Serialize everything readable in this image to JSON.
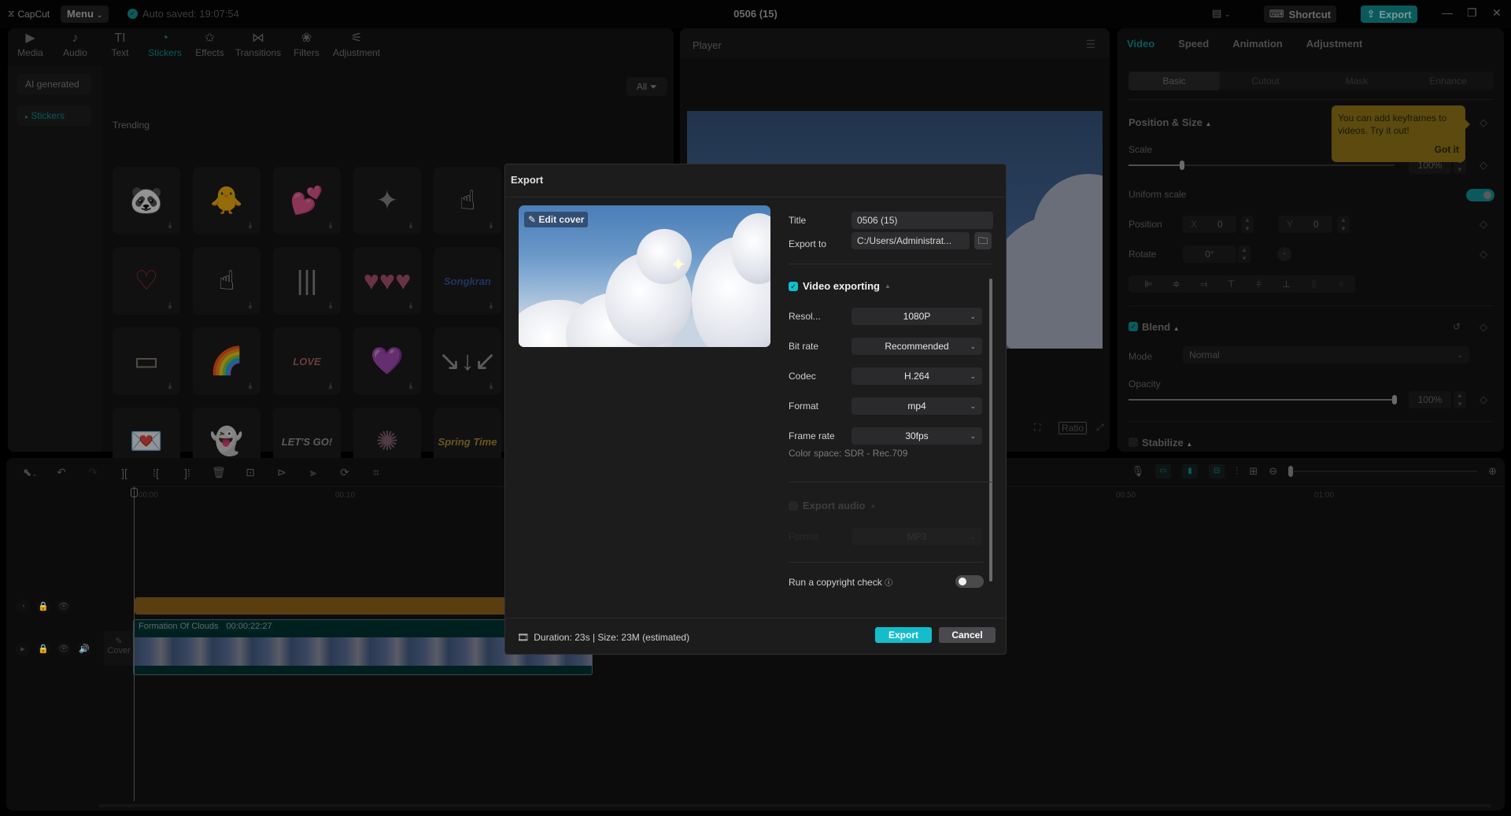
{
  "app": {
    "logo": "CapCut",
    "menu_label": "Menu",
    "autosave": "Auto saved: 19:07:54",
    "window_title": "0506 (15)",
    "shortcut_label": "Shortcut",
    "export_label": "Export",
    "accent_color": "#14bdcc"
  },
  "media_tabs": [
    {
      "label": "Media",
      "icon": "▶"
    },
    {
      "label": "Audio",
      "icon": "♪"
    },
    {
      "label": "Text",
      "icon": "TI"
    },
    {
      "label": "Stickers",
      "icon": "◔"
    },
    {
      "label": "Effects",
      "icon": "✩"
    },
    {
      "label": "Transitions",
      "icon": "⋈"
    },
    {
      "label": "Filters",
      "icon": "❀"
    },
    {
      "label": "Adjustment",
      "icon": "⚟"
    }
  ],
  "media_sidebar": {
    "ai_generated": "AI generated",
    "stickers": "Stickers"
  },
  "media_filter": "All",
  "trending_label": "Trending",
  "stickers": [
    {
      "name": "panda",
      "glyph": "🐼"
    },
    {
      "name": "chick",
      "glyph": "🐥"
    },
    {
      "name": "floating-hearts",
      "glyph": "💕"
    },
    {
      "name": "sparkles",
      "glyph": "✦"
    },
    {
      "name": "pointer-hand",
      "glyph": "☝"
    },
    {
      "name": "red-hearts",
      "glyph": "♡"
    },
    {
      "name": "pixel-hand",
      "glyph": "☝"
    },
    {
      "name": "sound-wave",
      "glyph": "|||"
    },
    {
      "name": "heart-row",
      "glyph": "♥♥♥"
    },
    {
      "name": "songkran",
      "glyph": "Songkran"
    },
    {
      "name": "tape",
      "glyph": "▭"
    },
    {
      "name": "rainbow",
      "glyph": "🌈"
    },
    {
      "name": "love-hearts",
      "glyph": "LOVE"
    },
    {
      "name": "arrow-heart",
      "glyph": "💜"
    },
    {
      "name": "arrows",
      "glyph": "↘↓↙"
    },
    {
      "name": "love-letters",
      "glyph": "💌"
    },
    {
      "name": "ghost",
      "glyph": "👻"
    },
    {
      "name": "lets-go",
      "glyph": "LET'S GO!"
    },
    {
      "name": "burst",
      "glyph": "✺"
    },
    {
      "name": "spring-time",
      "glyph": "Spring Time"
    }
  ],
  "player": {
    "title": "Player",
    "ratio_label": "Ratio"
  },
  "props": {
    "tabs": [
      "Video",
      "Speed",
      "Animation",
      "Adjustment"
    ],
    "subtabs": [
      "Basic",
      "Cutout",
      "Mask",
      "Enhance"
    ],
    "position_size": "Position & Size",
    "scale_label": "Scale",
    "scale_value": "100%",
    "scale_fraction": 0.2,
    "uniform_scale": "Uniform scale",
    "uniform_scale_on": true,
    "position_label": "Position",
    "x_label": "X",
    "x_value": "0",
    "y_label": "Y",
    "y_value": "0",
    "rotate_label": "Rotate",
    "rotate_value": "0°",
    "blend_label": "Blend",
    "mode_label": "Mode",
    "mode_value": "Normal",
    "opacity_label": "Opacity",
    "opacity_value": "100%",
    "opacity_fraction": 1.0,
    "stabilize_label": "Stabilize",
    "tooltip_text": "You can add keyframes to videos. Try it out!",
    "tooltip_button": "Got it"
  },
  "timeline": {
    "ticks": [
      "00:00",
      "00:10",
      "00:50",
      "01:00"
    ],
    "cover_label": "Cover",
    "clip_name": "Formation Of Clouds",
    "clip_duration": "00:00:22:27"
  },
  "export_dialog": {
    "title": "Export",
    "edit_cover": "Edit cover",
    "title_label": "Title",
    "title_value": "0506 (15)",
    "export_to_label": "Export to",
    "export_to_value": "C:/Users/Administrat...",
    "video_exporting_label": "Video exporting",
    "video_exporting_checked": true,
    "resolution_label": "Resol...",
    "resolution_value": "1080P",
    "bitrate_label": "Bit rate",
    "bitrate_value": "Recommended",
    "codec_label": "Codec",
    "codec_value": "H.264",
    "format_label": "Format",
    "format_value": "mp4",
    "framerate_label": "Frame rate",
    "framerate_value": "30fps",
    "color_space": "Color space: SDR - Rec.709",
    "export_audio_label": "Export audio",
    "export_audio_checked": false,
    "audio_format_label": "Format",
    "audio_format_value": "MP3",
    "copyright_label": "Run a copyright check",
    "copyright_on": false,
    "duration_info": "Duration: 23s | Size: 23M (estimated)",
    "export_button": "Export",
    "cancel_button": "Cancel"
  }
}
